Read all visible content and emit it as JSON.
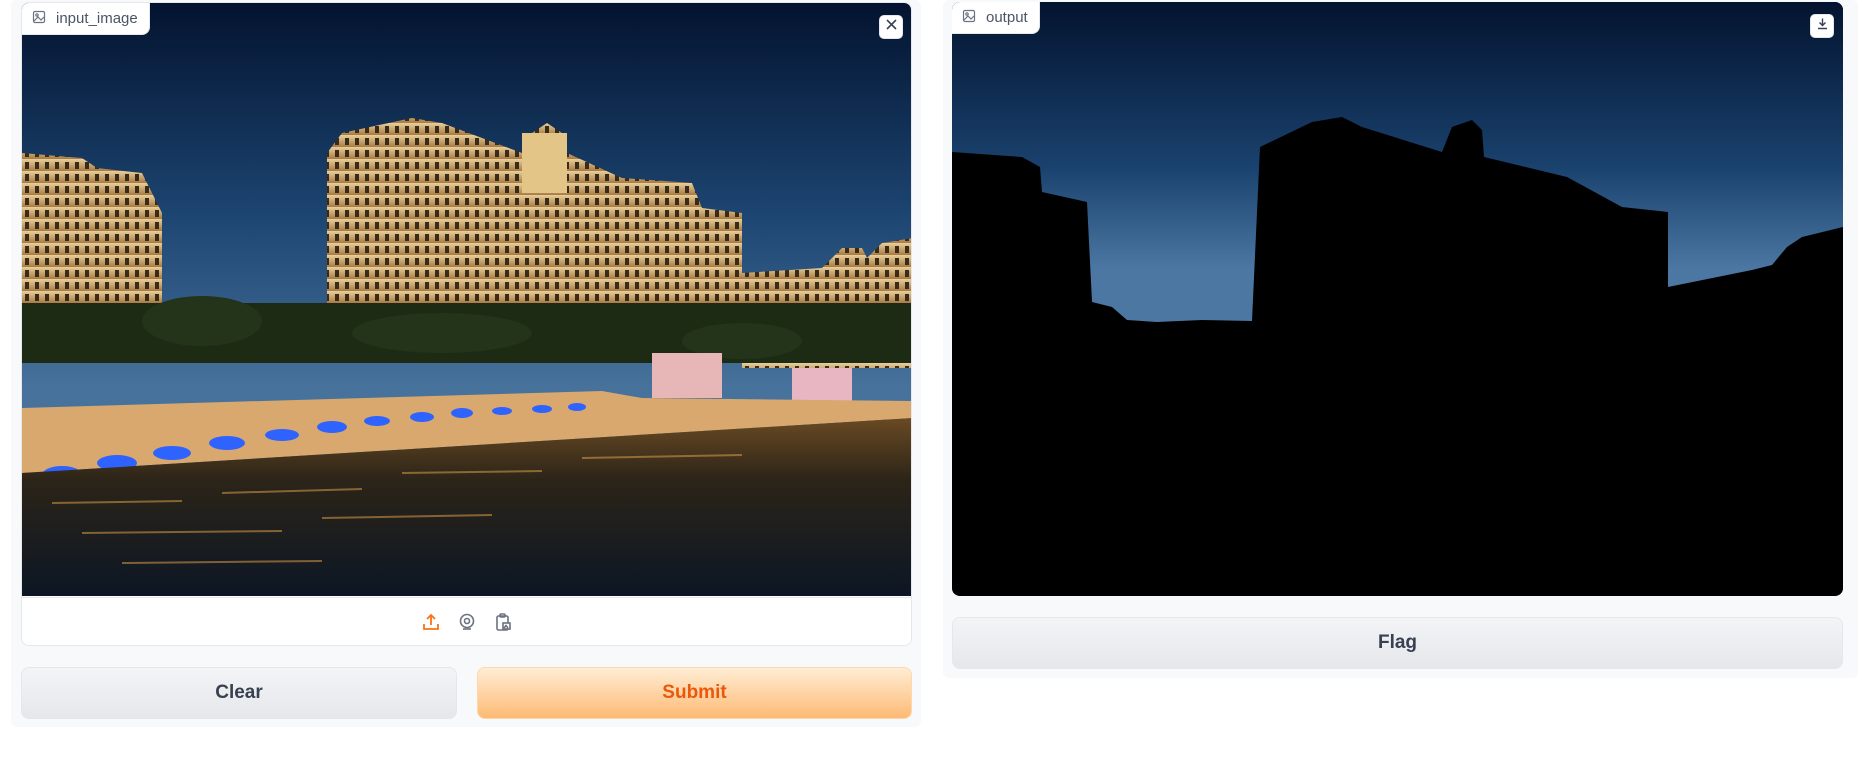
{
  "input": {
    "label": "input_image",
    "label_icon": "image-icon",
    "close_icon": "close-icon",
    "sources": [
      {
        "name": "upload-icon",
        "color": "#f97316"
      },
      {
        "name": "webcam-icon",
        "color": "#6b7280"
      },
      {
        "name": "clipboard-icon",
        "color": "#6b7280"
      }
    ]
  },
  "output": {
    "label": "output",
    "label_icon": "image-icon",
    "download_icon": "download-icon"
  },
  "buttons": {
    "clear_label": "Clear",
    "submit_label": "Submit",
    "flag_label": "Flag"
  },
  "colors": {
    "accent": "#f97316",
    "primary_text": "#ea580c",
    "sky_top": "#04163a",
    "sky_bottom": "#3f6f9e"
  }
}
